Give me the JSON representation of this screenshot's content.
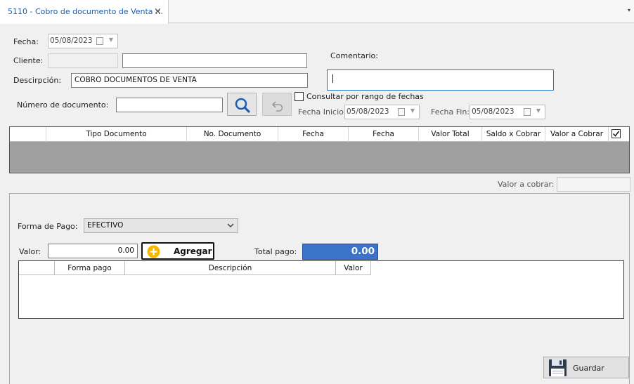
{
  "tab": {
    "title": "5110 - Cobro de documento de Venta ::.",
    "close": "×",
    "menu": "▾"
  },
  "form": {
    "fecha_label": "Fecha:",
    "fecha_value": "05/08/2023",
    "cliente_label": "Cliente:",
    "cliente_code": "",
    "cliente_name": "",
    "comentario_label": "Comentario:",
    "comentario_value": "",
    "descripcion_label": "Descirpción:",
    "descripcion_value": "COBRO DOCUMENTOS DE VENTA",
    "numero_label": "Número de documento:",
    "numero_value": "",
    "rango_label": "Consultar por rango de fechas",
    "fecha_inicio_label": "Fecha Inicio:",
    "fecha_inicio_value": "05/08/2023",
    "fecha_fin_label": "Fecha Fin:",
    "fecha_fin_value": "05/08/2023"
  },
  "icons": {
    "search": "magnifier-icon",
    "undo": "undo-arrow-icon",
    "calendar": "calendar-icon",
    "add": "plus-circle-icon",
    "save": "floppy-disk-icon"
  },
  "documents_grid": {
    "columns": [
      "Tipo Documento",
      "No. Documento",
      "Fecha",
      "Fecha",
      "Valor Total",
      "Saldo x Cobrar",
      "Valor a Cobrar"
    ],
    "select_all_checked": true,
    "rows": []
  },
  "valor_a_cobrar": {
    "label": "Valor a cobrar:",
    "value": ""
  },
  "payment": {
    "forma_label": "Forma de Pago:",
    "forma_value": "EFECTIVO",
    "valor_label": "Valor:",
    "valor_value": "0.00",
    "agregar_label": "Agregar",
    "total_label": "Total pago:",
    "total_value": "0.00"
  },
  "payments_grid": {
    "columns": [
      "Forma pago",
      "Descripción",
      "Valor"
    ],
    "rows": []
  },
  "guardar_label": "Guardar",
  "colors": {
    "accent": "#3b73c9",
    "tab_title": "#1f5da8",
    "grid_bg": "#a0a0a0",
    "add_icon": "#f5b800"
  }
}
